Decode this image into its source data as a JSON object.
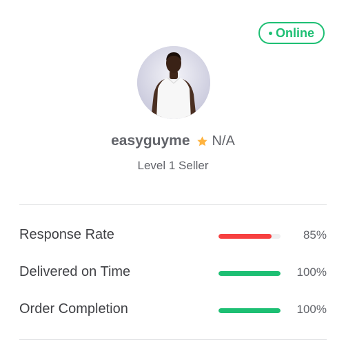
{
  "profile": {
    "status": "Online",
    "username": "easyguyme",
    "rating": "N/A",
    "level": "Level 1 Seller"
  },
  "stats": [
    {
      "label": "Response Rate",
      "value_text": "85%",
      "value": 85,
      "color": "#f74040"
    },
    {
      "label": "Delivered on Time",
      "value_text": "100%",
      "value": 100,
      "color": "#1dbf73"
    },
    {
      "label": "Order Completion",
      "value_text": "100%",
      "value": 100,
      "color": "#1dbf73"
    }
  ],
  "colors": {
    "accent_green": "#1dbf73",
    "warning_red": "#f74040",
    "star": "#ffb33e"
  }
}
